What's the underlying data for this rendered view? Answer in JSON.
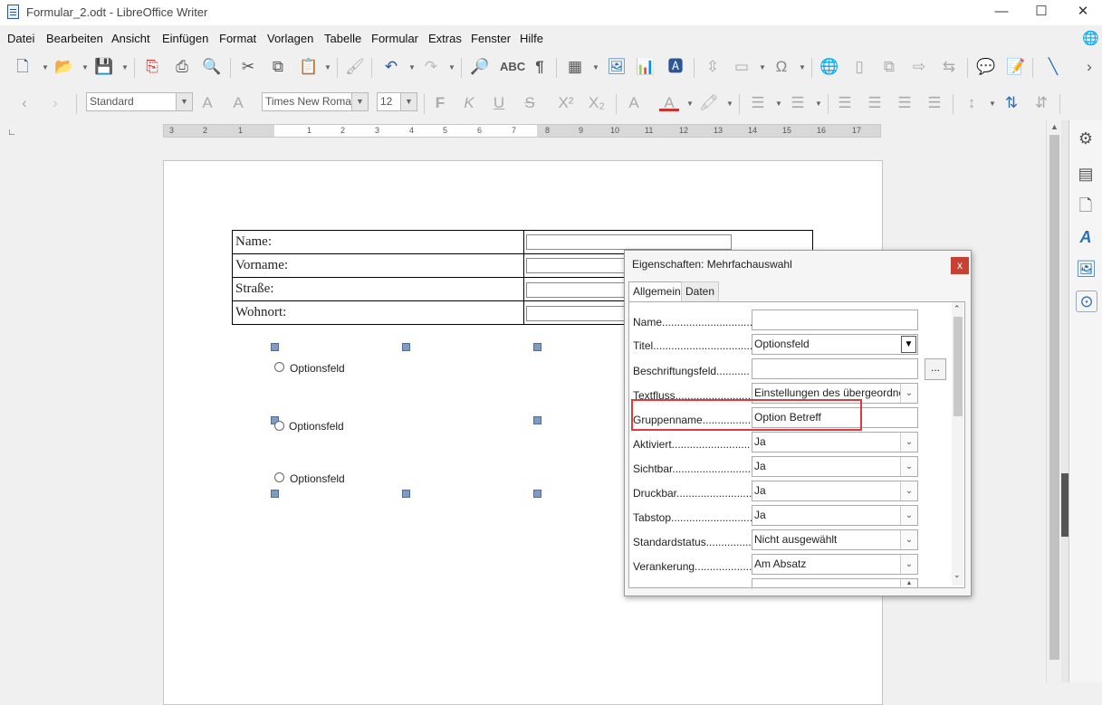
{
  "window": {
    "title": "Formular_2.odt - LibreOffice Writer",
    "minimize": "—",
    "maximize": "☐",
    "close": "✕"
  },
  "menu": [
    "Datei",
    "Bearbeiten",
    "Ansicht",
    "Einfügen",
    "Format",
    "Vorlagen",
    "Tabelle",
    "Formular",
    "Extras",
    "Fenster",
    "Hilfe"
  ],
  "formatting": {
    "paragraph_style": "Standard",
    "font_name": "Times New Roman",
    "font_size": "12"
  },
  "ruler": {
    "labels": [
      "3",
      "2",
      "1",
      "1",
      "2",
      "3",
      "4",
      "5",
      "6",
      "7",
      "8",
      "9",
      "10",
      "11",
      "12",
      "13",
      "14",
      "15",
      "16",
      "17"
    ]
  },
  "form_table": {
    "rows": [
      "Name:",
      "Vorname:",
      "Straße:",
      "Wohnort:"
    ]
  },
  "option_fields": [
    "Optionsfeld",
    "Optionsfeld",
    "Optionsfeld"
  ],
  "dialog": {
    "title": "Eigenschaften: Mehrfachauswahl",
    "close_label": "x",
    "tabs": [
      "Allgemein",
      "Daten"
    ],
    "browse_label": "...",
    "properties": [
      {
        "label": "Name...............................",
        "value": ""
      },
      {
        "label": "Titel.................................",
        "value": "Optionsfeld"
      },
      {
        "label": "Beschriftungsfeld...........",
        "value": ""
      },
      {
        "label": "Textfluss.........................",
        "value": "Einstellungen des übergeordneten"
      },
      {
        "label": "Gruppenname................",
        "value": "Option Betreff"
      },
      {
        "label": "Aktiviert..........................",
        "value": "Ja"
      },
      {
        "label": "Sichtbar...........................",
        "value": "Ja"
      },
      {
        "label": "Druckbar..........................",
        "value": "Ja"
      },
      {
        "label": "Tabstop............................",
        "value": "Ja"
      },
      {
        "label": "Standardstatus................",
        "value": "Nicht ausgewählt"
      },
      {
        "label": "Verankerung...................",
        "value": "Am Absatz"
      }
    ]
  },
  "colors": {
    "highlight": "#e03a3e",
    "close_button": "#c84031",
    "handle": "#7a9cc6"
  }
}
